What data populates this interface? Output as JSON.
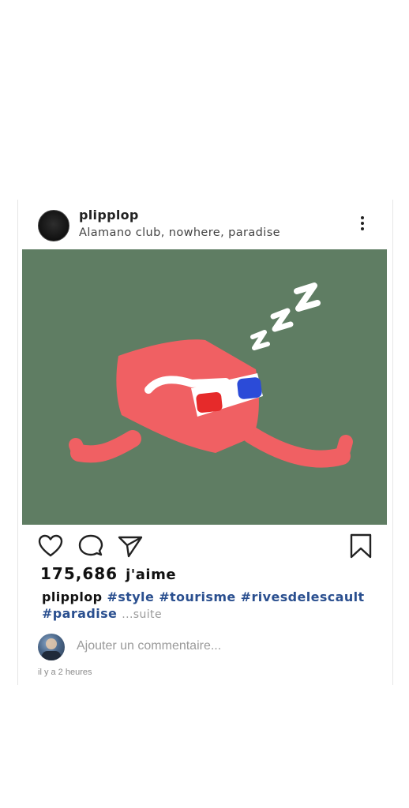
{
  "post": {
    "username": "plipplop",
    "location": "Alamano club, nowhere, paradise",
    "photo_colors": {
      "background": "#5f7d63",
      "character": "#f06063",
      "glasses_red": "#e62a2a",
      "glasses_blue": "#2b4bd8"
    },
    "actions": {
      "like_icon": "heart-icon",
      "comment_icon": "comment-icon",
      "share_icon": "send-icon",
      "save_icon": "bookmark-icon"
    },
    "likes_count": "175,686",
    "likes_word": "j'aime",
    "caption": {
      "user": "plipplop",
      "tags": [
        "#style",
        "#tourisme",
        "#rivesdelescault",
        "#paradise"
      ],
      "more": "...suite"
    },
    "comment_placeholder": "Ajouter un commentaire...",
    "timestamp": "il y a 2 heures"
  }
}
